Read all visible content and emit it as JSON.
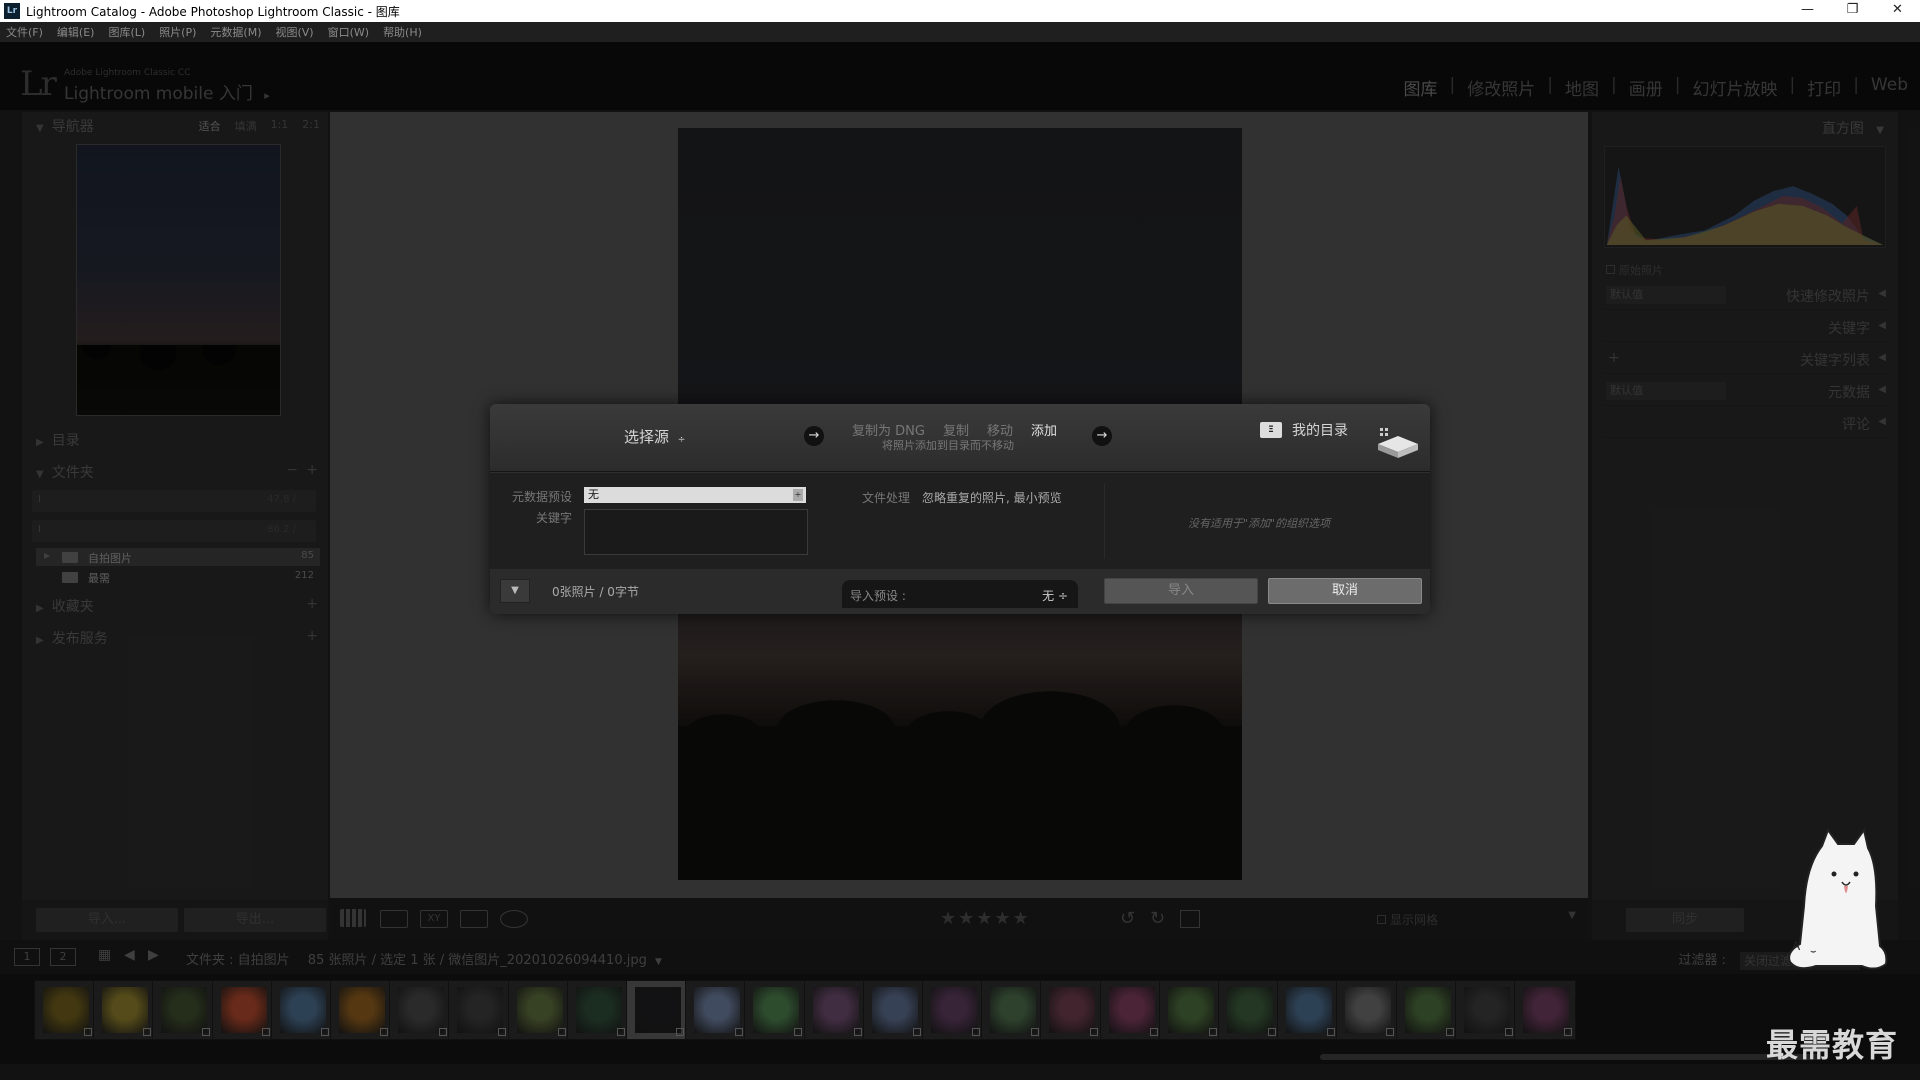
{
  "window": {
    "title": "Lightroom Catalog - Adobe Photoshop Lightroom Classic - 图库",
    "app_icon": "Lr",
    "controls": [
      "—",
      "❐",
      "✕"
    ]
  },
  "menu": [
    "文件(F)",
    "编辑(E)",
    "图库(L)",
    "照片(P)",
    "元数据(M)",
    "视图(V)",
    "窗口(W)",
    "帮助(H)"
  ],
  "identity": {
    "logo": "Lr",
    "small": "Adobe Lightroom Classic CC",
    "large": "Lightroom mobile 入门",
    "arrow": "▸"
  },
  "modules": [
    "图库",
    "修改照片",
    "地图",
    "画册",
    "幻灯片放映",
    "打印",
    "Web"
  ],
  "module_separator": "|",
  "left_panel": {
    "navigator": {
      "title": "导航器",
      "options": [
        "适合",
        "填满",
        "1:1",
        "2:1"
      ]
    },
    "catalog": {
      "title": "目录"
    },
    "folders": {
      "title": "文件夹",
      "volumes": [
        {
          "name": "I",
          "size": "47.8 / "
        },
        {
          "name": "I",
          "size": "86.2 / "
        }
      ],
      "items": [
        {
          "label": "自拍图片",
          "count": "85"
        },
        {
          "label": "最需",
          "count": "212"
        }
      ]
    },
    "collections": {
      "title": "收藏夹"
    },
    "publish": {
      "title": "发布服务"
    },
    "buttons": {
      "import": "导入...",
      "export": "导出..."
    }
  },
  "right_panel": {
    "histogram": {
      "title": "直方图",
      "original_photo": "原始照片"
    },
    "quick_develop": {
      "preset": "默认值",
      "title": "快速修改照片"
    },
    "keywording": {
      "title": "关键字"
    },
    "keyword_list": {
      "title": "关键字列表"
    },
    "metadata": {
      "preset": "默认值",
      "title": "元数据"
    },
    "comments": {
      "title": "评论"
    },
    "sync": "同步"
  },
  "toolbar": {
    "stars": "★★★★★",
    "xy": "XY",
    "thumbnails_label": "显示网格"
  },
  "filmstrip_bar": {
    "page1": "1",
    "page2": "2",
    "path": "文件夹 : 自拍图片",
    "count": "85 张照片 / 选定 1 张 / 微信图片_20201026094410.jpg",
    "filter_label": "过滤器 :",
    "filter_value": "关闭过滤器"
  },
  "filmstrip": {
    "colors": [
      "#6b5a1a",
      "#8a7a2a",
      "#3c4a2c",
      "#a8442a",
      "#4a6a8a",
      "#8a5a1c",
      "#454545",
      "#3a3a3a",
      "#5a6a3a",
      "#2d4a36",
      "#1d1d22",
      "#6a7a9a",
      "#4a7a4a",
      "#6a4a6a",
      "#5a6a8a",
      "#5a3a5a",
      "#4a6a4a",
      "#6a3a4a",
      "#7a3a5a",
      "#4a6a3a",
      "#3a5a3a",
      "#4a6a8a",
      "#6a6a6a",
      "#4a6a3a",
      "#3a3a3a",
      "#6a3a5a"
    ],
    "selected_index": 10
  },
  "dialog": {
    "source": "选择源",
    "modes": [
      "复制为 DNG",
      "复制",
      "移动",
      "添加"
    ],
    "active_mode": "添加",
    "mode_desc": "将照片添加到目录而不移动",
    "destination": "我的目录",
    "dest_icon": "Ξ",
    "metadata_preset_label": "元数据预设",
    "metadata_preset_value": "无",
    "keywords_label": "关键字",
    "file_handling_label": "文件处理",
    "file_handling_value": "忽略重复的照片, 最小预览",
    "no_options": "没有适用于\"添加\"的组织选项",
    "count": "0张照片 / 0字节",
    "import_preset_label": "导入预设 :",
    "import_preset_value": "无 ÷",
    "import_button": "导入",
    "cancel_button": "取消"
  },
  "watermark": "最需教育"
}
